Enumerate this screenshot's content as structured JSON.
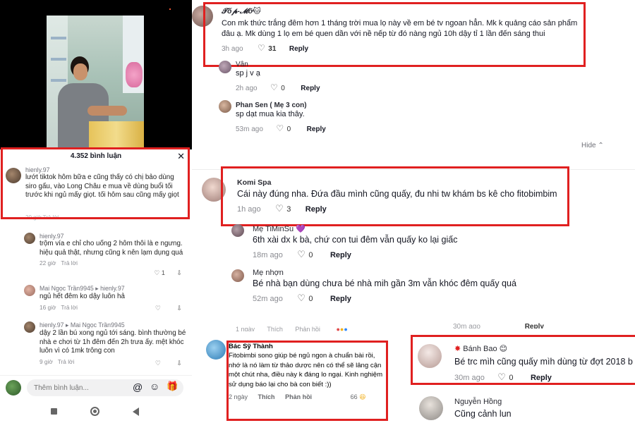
{
  "left": {
    "comment_count": "4.352 bình luận",
    "comments": [
      {
        "name": "hienly.97",
        "text": "lướt tiktok hôm bữa e cũng thấy có chị bảo dùng siro gấu, vào Long Châu e mua về dùng buổi tối trước khi ngủ mấy giọt. tối hôm sau cũng mấy giọt",
        "time": "",
        "reply": "Trả lời",
        "likes": "",
        "truncated": "20 giờ   Trả lời"
      },
      {
        "name": "hienly.97",
        "text": "trộm vía e chỉ cho uống 2 hôm thôi là e ngưng. hiệu quả thật, nhưng cũng k nên lạm dụng quá",
        "time": "22 giờ",
        "reply": "Trả lời",
        "likes": "1"
      },
      {
        "name": "Mai Ngọc Trần9945",
        "replying_to": "hienly.97",
        "text": "ngủ hết đêm ko dậy luôn hả",
        "time": "16 giờ",
        "reply": "Trả lời",
        "likes": ""
      },
      {
        "name": "hienly.97",
        "replying_to": "Mai Ngọc Trần9945",
        "text": "dậy 2 lần bú xong ngủ tới sáng. bình thường bé nhà e chơi từ 1h đêm đến 2h trưa ấy. mệt khóc luôn vì có 1mk trông con",
        "time": "9 giờ",
        "reply": "Trả lời",
        "likes": ""
      }
    ],
    "input_placeholder": "Thêm bình luận...",
    "nav": [
      "square",
      "circle",
      "triangle"
    ]
  },
  "middle": {
    "comments": [
      {
        "name": "𝓣ố𝓹-𝓜ỡ🐱",
        "text": "Con mk thức trắng đêm hơn 1 tháng trời mua lọ này về em bé tv ngoan hẳn. Mk k quảng cáo sản phẩm đâu ạ. Mk dùng 1 lọ em bé quen dần với nề nếp từ đó nàng ngủ 10h dậy tỉ 1 lần đến sáng thui",
        "time": "3h ago",
        "likes": "31",
        "reply": "Reply"
      },
      {
        "name": "Vân",
        "text": "sp j v ạ",
        "time": "2h ago",
        "likes": "0",
        "reply": "Reply"
      },
      {
        "name": "Phan Sen ( Mẹ 3 con)",
        "text": "sp dạt mua kia thây.",
        "time": "53m ago",
        "likes": "0",
        "reply": "Reply"
      }
    ],
    "hide_label": "Hide",
    "comments2": [
      {
        "name": "Komi Spa",
        "text": "Cái này đúng nha. Đứa đầu mình cũng quấy, đu nhi tw khám bs kê cho fitobimbim",
        "time": "1h ago",
        "likes": "3",
        "reply": "Reply"
      },
      {
        "name": "Mẹ TiMinSu 💜",
        "text": "6th xài dx k bà, chứ con tui đêm vẫn quấy ko lại giấc",
        "time": "18m ago",
        "likes": "0",
        "reply": "Reply"
      },
      {
        "name": "Mẹ nhợn",
        "text": "Bé nhà bạn dùng chưa bé nhà mih gần 3m vẫn khóc đêm quấy quá",
        "time": "52m ago",
        "likes": "0",
        "reply": "Reply"
      }
    ],
    "fb_comment": {
      "name": "Bác Sỹ Thành",
      "text": "Fitobimbi sono giúp bé ngủ ngon à chuẩn bài rồi, nhớ là nó làm từ thảo dược nên có thể sẽ lâng cận một chút nha, điều này k đáng lo ngại. Kinh nghiệm sử dụng báo lại cho bà con biết :))",
      "time": "2 ngày",
      "like": "Thích",
      "reply": "Phản hồi",
      "reactions": "66"
    },
    "fb_partial": {
      "time": "1 ngày",
      "like": "Thích",
      "reply": "Phản hồi"
    }
  },
  "right": {
    "partial": {
      "time": "30m ago",
      "reply": "Reply"
    },
    "comments": [
      {
        "name": "Bánh Bao 😊",
        "text": "Bé trc mìh cũng quấy mìh dùng từ đợt 2018 b",
        "time": "30m ago",
        "likes": "0",
        "reply": "Reply"
      },
      {
        "name": "Nguyễn Hồng",
        "text": "Cũng cảnh lun",
        "time": "",
        "likes": "",
        "reply": ""
      }
    ]
  }
}
